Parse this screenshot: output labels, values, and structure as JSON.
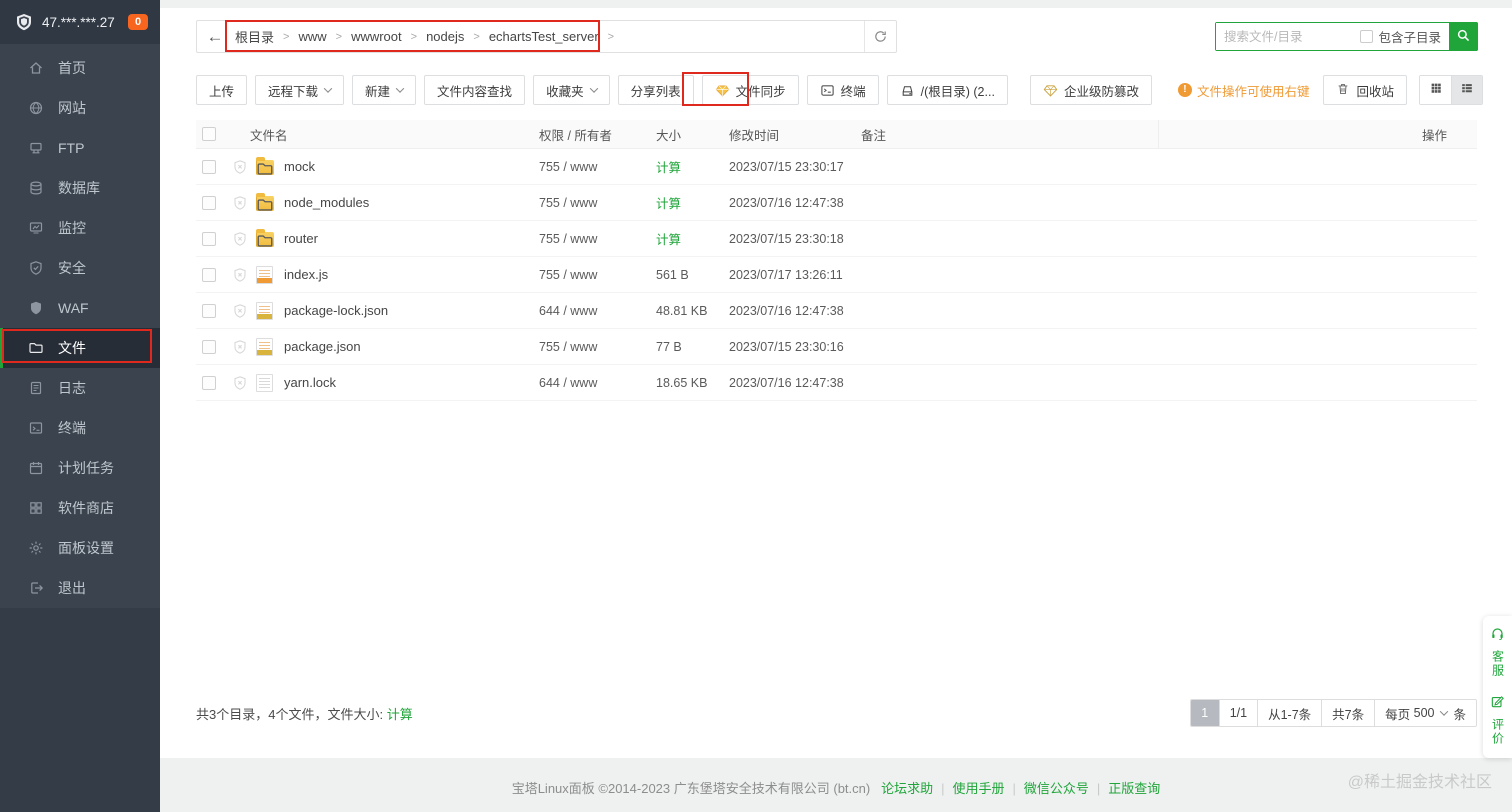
{
  "sidebar": {
    "server_ip": "47.***.***.27",
    "badge_count": "0",
    "items": [
      {
        "label": "首页",
        "icon": "home"
      },
      {
        "label": "网站",
        "icon": "globe"
      },
      {
        "label": "FTP",
        "icon": "ftp"
      },
      {
        "label": "数据库",
        "icon": "database"
      },
      {
        "label": "监控",
        "icon": "monitor"
      },
      {
        "label": "安全",
        "icon": "shield-check"
      },
      {
        "label": "WAF",
        "icon": "shield-solid"
      },
      {
        "label": "文件",
        "icon": "folder",
        "active": true
      },
      {
        "label": "日志",
        "icon": "log"
      },
      {
        "label": "终端",
        "icon": "terminal"
      },
      {
        "label": "计划任务",
        "icon": "cron"
      },
      {
        "label": "软件商店",
        "icon": "store"
      },
      {
        "label": "面板设置",
        "icon": "gear"
      },
      {
        "label": "退出",
        "icon": "logout"
      }
    ]
  },
  "topbar": {
    "breadcrumb": [
      "根目录",
      "www",
      "wwwroot",
      "nodejs",
      "echartsTest_server"
    ],
    "search": {
      "placeholder": "搜索文件/目录",
      "subdir_label": "包含子目录"
    }
  },
  "toolbar": {
    "buttons": [
      {
        "label": "上传"
      },
      {
        "label": "远程下载",
        "dropdown": true
      },
      {
        "label": "新建",
        "dropdown": true
      },
      {
        "label": "文件内容查找"
      },
      {
        "label": "收藏夹",
        "dropdown": true
      },
      {
        "label": "分享列表"
      },
      {
        "label": "文件同步",
        "icon": "gem"
      },
      {
        "label": "终端",
        "icon": "terminal-small"
      },
      {
        "label": "/(根目录) (2...",
        "icon": "disk"
      },
      {
        "label": "企业级防篡改",
        "icon": "gem-outline",
        "gap_before": true
      }
    ],
    "tip": "文件操作可使用右键",
    "recycle_label": "回收站"
  },
  "table": {
    "headers": {
      "name": "文件名",
      "perm": "权限 / 所有者",
      "size": "大小",
      "mtime": "修改时间",
      "note": "备注",
      "ops": "操作"
    },
    "rows": [
      {
        "name": "mock",
        "type": "folder",
        "perm": "755 / www",
        "size": "计算",
        "size_link": true,
        "mtime": "2023/07/15 23:30:17",
        "note": ""
      },
      {
        "name": "node_modules",
        "type": "folder",
        "perm": "755 / www",
        "size": "计算",
        "size_link": true,
        "mtime": "2023/07/16 12:47:38",
        "note": ""
      },
      {
        "name": "router",
        "type": "folder",
        "perm": "755 / www",
        "size": "计算",
        "size_link": true,
        "mtime": "2023/07/15 23:30:18",
        "note": ""
      },
      {
        "name": "index.js",
        "type": "js",
        "perm": "755 / www",
        "size": "561 B",
        "mtime": "2023/07/17 13:26:11",
        "note": ""
      },
      {
        "name": "package-lock.json",
        "type": "json",
        "perm": "644 / www",
        "size": "48.81 KB",
        "mtime": "2023/07/16 12:47:38",
        "note": ""
      },
      {
        "name": "package.json",
        "type": "json",
        "perm": "755 / www",
        "size": "77 B",
        "mtime": "2023/07/15 23:30:16",
        "note": ""
      },
      {
        "name": "yarn.lock",
        "type": "file",
        "perm": "644 / www",
        "size": "18.65 KB",
        "mtime": "2023/07/16 12:47:38",
        "note": ""
      }
    ]
  },
  "statusbar": {
    "summary_prefix": "共3个目录，4个文件，文件大小: ",
    "summary_link": "计算",
    "pagination": {
      "page": "1",
      "page_info": "1/1",
      "range": "从1-7条",
      "total": "共7条",
      "per_page_prefix": "每页",
      "per_page": "500",
      "per_page_suffix": "条"
    }
  },
  "footer": {
    "copyright": "宝塔Linux面板 ©2014-2023 广东堡塔安全技术有限公司 (bt.cn)",
    "links": [
      "论坛求助",
      "使用手册",
      "微信公众号",
      "正版查询"
    ]
  },
  "widget": {
    "service_label": "客服",
    "review_label": "评价"
  },
  "watermark": "@稀土掘金技术社区",
  "colors": {
    "accent_green": "#20a53a",
    "badge_orange": "#f7651f",
    "tip_orange": "#ef9a33",
    "annotation_red": "#e0291e",
    "sidebar_bg": "#3b434e",
    "folder_yellow": "#f0bb3e"
  }
}
